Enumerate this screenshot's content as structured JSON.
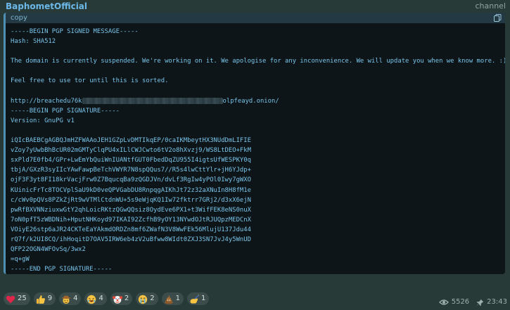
{
  "post": {
    "author": "BaphometOfficial",
    "badge": "channel",
    "views": "5526",
    "time": "23:43"
  },
  "code": {
    "language": "copy",
    "lines_before": [
      "-----BEGIN PGP SIGNED MESSAGE-----",
      "Hash: SHA512",
      "",
      "The domain is currently suspended. We're working on it. We apologise for any inconvenience. We will update you when we know more. :)",
      "",
      "Feel free to use tor until this is sorted.",
      ""
    ],
    "url_start": "http://breachedu76k",
    "url_end": "olpfeayd.onion/",
    "lines_after": [
      "-----BEGIN PGP SIGNATURE-----",
      "Version: GnuPG v1",
      "",
      "iQIcBAEBCgAGBQJmHZFWAAoJEH1GZpLvDMTIkqEP/0caIKMbeytHX3NUdDmLIFIE",
      "vZoy7yUwbBhBcUR02mGMTyClqPU4xILlCWJCwto6tV2o8hXvzj9/WS8LtDEO+FkM",
      "sxPld7E0fb4/GPr+LwEmYbQuiWnIUANtfGUT0FbedDqZU955I4igtsUfWESPKY0q",
      "tbjA/GXzR3syIIcYAwFawpBeTchVWYR7N8spQQus7//R5s4lwCttYlr+jH6YJdp+",
      "ojF3F3yt8FI18krVacjFrw0Z7BqucqBa9zQGDJVn/dvLf3RgIw4yPOl0Iwy7gWXO",
      "KUinicFrTc8TOCVplSaU9kD0veQPVGabDU8RnpqgAIKhJt72z32aXNuIn8H8fM1e",
      "c/cWv0pQVs8PZkZjRt9wVTMlCtdnWU+5s9eWjqKQ1Iw72fktrr7GRj2/d3xX6ejN",
      "pwRfBXVNNziuxwGtY2qhLoicRKtzQGwQQsiz8OydEve6PX1+t3WifFEK8eNS0nuX",
      "7oN0pfT5zWBDNih+HputNHKoyd97IKAI92ZcfhB9yOY13NYwdOJtRJUQpzMEDCnX",
      "VOiyE26stp6aJR24CKTeEaYAkmdORDZn8mf6ZWafN3V8WwFEk56MlujU137Jdu44",
      "rQ7f/k2UI8CQ/ihHoqitD7OAV5IRW6eb4zV2uBfww8WIdt0ZXJ3SN7JvJ4y5WnUD",
      "QFP22OGN4WFOvSq/3wx2",
      "=q+gW",
      "-----END PGP SIGNATURE-----"
    ]
  },
  "reactions": [
    {
      "emoji": "heart-emoji",
      "count": "25"
    },
    {
      "emoji": "thumbs-up-emoji",
      "count": "9"
    },
    {
      "emoji": "cowboy-emoji",
      "count": "4"
    },
    {
      "emoji": "rofl-emoji",
      "count": "4"
    },
    {
      "emoji": "clown-emoji",
      "count": "2"
    },
    {
      "emoji": "crying-emoji",
      "count": "2"
    },
    {
      "emoji": "poop-emoji",
      "count": "1"
    },
    {
      "emoji": "writing-hand-emoji",
      "count": "1"
    }
  ],
  "colors": {
    "author": "#6cb8e8",
    "code_text": "#78c4ea",
    "code_bg": "#0e1518",
    "accent_border": "#4f8fb3",
    "bubble_bg": "#273a37"
  }
}
